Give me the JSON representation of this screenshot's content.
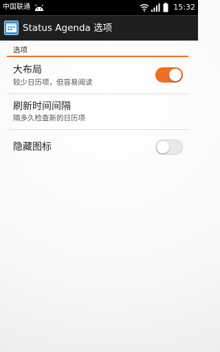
{
  "status_bar": {
    "carrier": "中国联通",
    "time": "15:32",
    "icons": [
      "android-notification-icon",
      "wifi-icon",
      "signal-icon",
      "battery-icon"
    ]
  },
  "action_bar": {
    "app_icon": "calendar-app-icon",
    "title": "Status Agenda 选项"
  },
  "section": {
    "header": "选项"
  },
  "preferences": [
    {
      "title": "大布局",
      "summary": "较少日历项，但容易阅读",
      "toggle": "on"
    },
    {
      "title": "刷新时间间隔",
      "summary": "隔多久检查新的日历项"
    },
    {
      "title": "隐藏图标",
      "toggle": "off"
    }
  ],
  "colors": {
    "accent": "#f26f21",
    "action_bar": "#1f1f1f",
    "status_bar": "#000000"
  }
}
